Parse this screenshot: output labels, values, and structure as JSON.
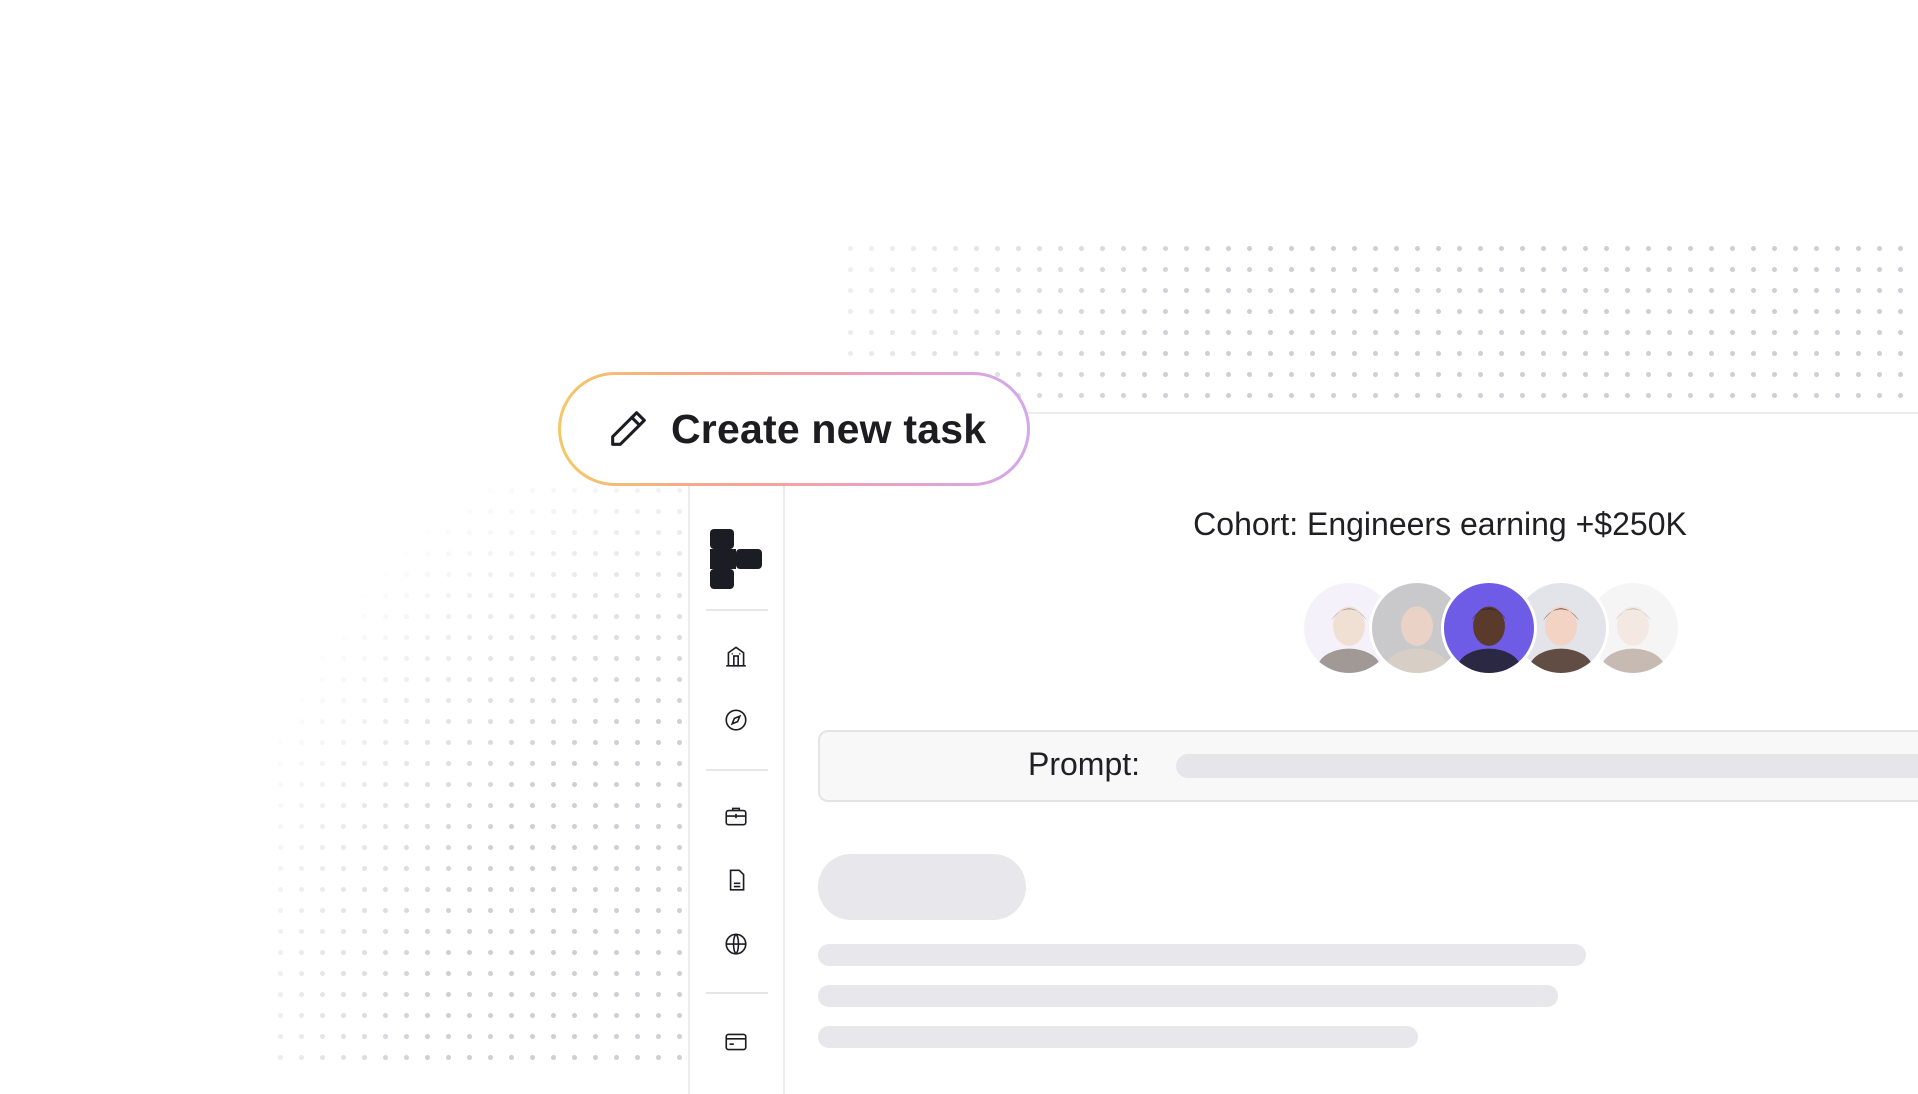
{
  "create_task": {
    "label": "Create new task",
    "icon": "pencil-icon"
  },
  "cohort": {
    "title": "Cohort: Engineers earning +$250K",
    "avatars": [
      {
        "name": "person-1",
        "bg": "#ece7f7",
        "skin": "#e5c7b0",
        "hair": "#3a2a20",
        "faded": true
      },
      {
        "name": "person-2",
        "bg": "#c9c9cb",
        "skin": "#ead3c6",
        "hair": "#d9cfc6",
        "faded": false
      },
      {
        "name": "person-3",
        "bg": "#6f5ce6",
        "skin": "#5a3a2a",
        "hair": "#1e1e24",
        "faded": false
      },
      {
        "name": "person-4",
        "bg": "#e3e3ea",
        "skin": "#f2d3c4",
        "hair": "#4a3226",
        "faded": false
      },
      {
        "name": "person-5",
        "bg": "#ededed",
        "skin": "#ead7cc",
        "hair": "#8a7060",
        "faded": true
      }
    ]
  },
  "prompt": {
    "label": "Prompt:"
  },
  "sidebar": {
    "logo": "app-logo",
    "icons": [
      "building-icon",
      "compass-icon",
      "briefcase-icon",
      "document-icon",
      "globe-icon",
      "card-icon"
    ]
  },
  "colors": {
    "accent_gradient": [
      "#f6c766",
      "#f0a0b3",
      "#d3a7ef"
    ],
    "skeleton": "#e8e8ec",
    "highlight_avatar": "#6f5ce6"
  }
}
